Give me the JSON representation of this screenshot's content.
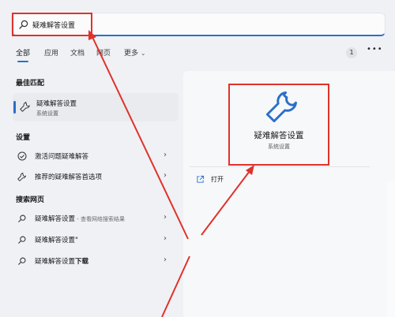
{
  "search": {
    "value": "疑难解答设置",
    "placeholder": ""
  },
  "tabs": [
    {
      "label": "全部",
      "active": true
    },
    {
      "label": "应用",
      "active": false
    },
    {
      "label": "文档",
      "active": false
    },
    {
      "label": "网页",
      "active": false
    },
    {
      "label": "更多",
      "active": false
    }
  ],
  "tab_more_chevron": "⌄",
  "badge_count": "1",
  "more_menu": "•••",
  "best_match": {
    "heading": "最佳匹配",
    "title": "疑难解答设置",
    "subtitle": "系统设置"
  },
  "settings_section": {
    "heading": "设置",
    "items": [
      {
        "label": "激活问题疑难解答",
        "icon": "check-circle-icon"
      },
      {
        "label": "推荐的疑难解答首选项",
        "icon": "wrench-icon"
      }
    ]
  },
  "web_section": {
    "heading": "搜索网页",
    "items": [
      {
        "label": "疑难解答设置",
        "suffix": " - 查看网络搜索结果"
      },
      {
        "label": "疑难解答设置\"",
        "suffix": ""
      },
      {
        "label": "疑难解答设置",
        "suffix": "下载"
      }
    ]
  },
  "chevron": "›",
  "detail": {
    "title": "疑难解答设置",
    "subtitle": "系统设置",
    "open_label": "打开"
  },
  "colors": {
    "accent": "#2a6fc9",
    "annotation": "#e0322a"
  }
}
